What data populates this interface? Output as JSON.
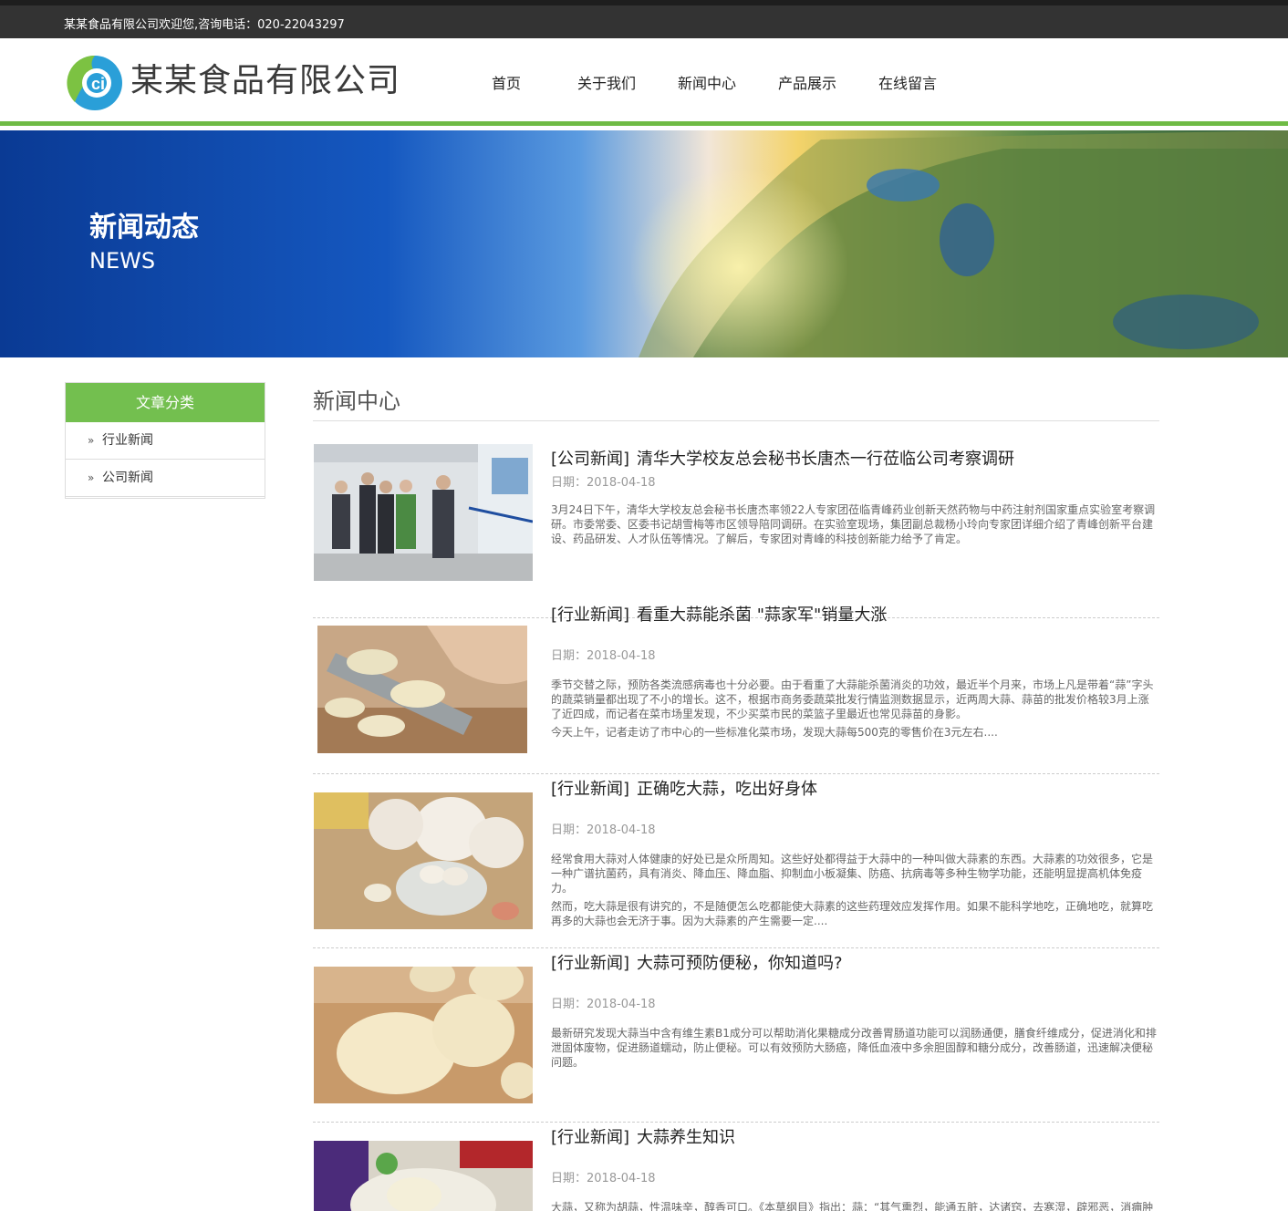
{
  "topbar": {
    "text": "某某食品有限公司欢迎您,咨询电话：020-22043297"
  },
  "header": {
    "company_name": "某某食品有限公司",
    "nav": [
      "首页",
      "关于我们",
      "新闻中心",
      "产品展示",
      "在线留言"
    ]
  },
  "banner": {
    "title": "新闻动态",
    "subtitle": "NEWS"
  },
  "sidebar": {
    "heading": "文章分类",
    "items": [
      {
        "label": "行业新闻"
      },
      {
        "label": "公司新闻"
      }
    ]
  },
  "main": {
    "title": "新闻中心",
    "articles": [
      {
        "category": "[公司新闻]",
        "title": "清华大学校友总会秘书长唐杰一行莅临公司考察调研",
        "date": "日期：2018-04-18",
        "paragraphs": [
          "3月24日下午，清华大学校友总会秘书长唐杰率领22人专家团莅临青峰药业创新天然药物与中药注射剂国家重点实验室考察调研。市委常委、区委书记胡雪梅等市区领导陪同调研。在实验室现场，集团副总裁杨小玲向专家团详细介绍了青峰创新平台建设、药品研发、人才队伍等情况。了解后，专家团对青峰的科技创新能力给予了肯定。"
        ]
      },
      {
        "category": "[行业新闻]",
        "title": "看重大蒜能杀菌 \"蒜家军\"销量大涨",
        "date": "日期：2018-04-18",
        "paragraphs": [
          "季节交替之际，预防各类流感病毒也十分必要。由于看重了大蒜能杀菌消炎的功效，最近半个月来，市场上凡是带着“蒜”字头的蔬菜销量都出现了不小的增长。这不，根据市商务委蔬菜批发行情监测数据显示，近两周大蒜、蒜苗的批发价格较3月上涨了近四成，而记者在菜市场里发现，不少买菜市民的菜篮子里最近也常见蒜苗的身影。",
          "今天上午，记者走访了市中心的一些标准化菜市场，发现大蒜每500克的零售价在3元左右...."
        ]
      },
      {
        "category": "[行业新闻]",
        "title": "正确吃大蒜，吃出好身体",
        "date": "日期：2018-04-18",
        "paragraphs": [
          "经常食用大蒜对人体健康的好处已是众所周知。这些好处都得益于大蒜中的一种叫做大蒜素的东西。大蒜素的功效很多，它是一种广谱抗菌药，具有消炎、降血压、降血脂、抑制血小板凝集、防癌、抗病毒等多种生物学功能，还能明显提高机体免疫力。",
          "然而，吃大蒜是很有讲究的，不是随便怎么吃都能使大蒜素的这些药理效应发挥作用。如果不能科学地吃，正确地吃，就算吃再多的大蒜也会无济于事。因为大蒜素的产生需要一定...."
        ]
      },
      {
        "category": "[行业新闻]",
        "title": "大蒜可预防便秘，你知道吗?",
        "date": "日期：2018-04-18",
        "paragraphs": [
          "最新研究发现大蒜当中含有维生素B1成分可以帮助消化果糖成分改善胃肠道功能可以润肠通便，膳食纤维成分，促进消化和排泄固体废物，促进肠道蠕动，防止便秘。可以有效预防大肠癌，降低血液中多余胆固醇和糖分成分，改善肠道，迅速解决便秘问题。"
        ]
      },
      {
        "category": "[行业新闻]",
        "title": "大蒜养生知识",
        "date": "日期：2018-04-18",
        "paragraphs": [
          "大蒜，又称为胡蒜，性温味辛，醇香可口。《本草纲目》指出：蒜：“其气熏烈，能通五脏，达诸窍，去寒湿，辟邪恶，消痈肿"
        ]
      }
    ]
  },
  "colors": {
    "accent_green": "#6fbb45",
    "topbar": "#333333",
    "banner_blue": "#0a3d9a"
  }
}
